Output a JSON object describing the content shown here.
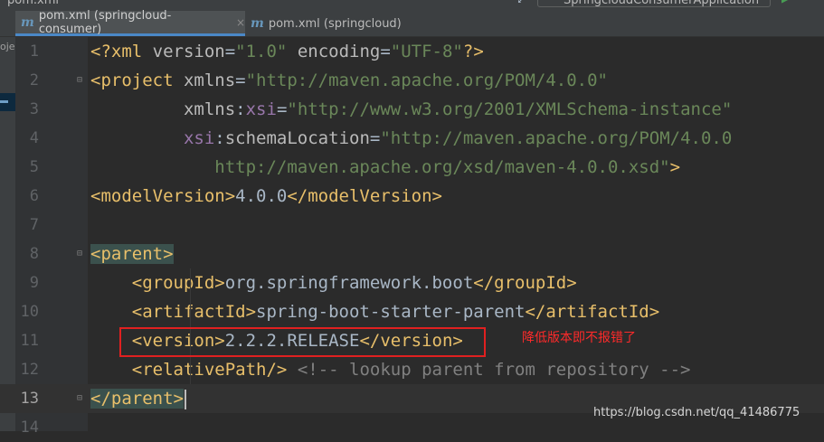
{
  "window": {
    "title": "pom.xml",
    "run_config": "SpringcloudConsumerApplication"
  },
  "tabs": [
    {
      "label": "pom.xml (springcloud-consumer)",
      "active": true,
      "close": "×"
    },
    {
      "label": "pom.xml (springcloud)",
      "active": false
    }
  ],
  "sidebar": {
    "label": "oje"
  },
  "editor": {
    "current_line": 13,
    "lines": [
      {
        "n": "1",
        "tokens": [
          [
            "tag",
            "<?xml "
          ],
          [
            "attr",
            "version"
          ],
          [
            "txt",
            "="
          ],
          [
            "str",
            "\"1.0\""
          ],
          [
            "txt",
            " "
          ],
          [
            "attr",
            "encoding"
          ],
          [
            "txt",
            "="
          ],
          [
            "str",
            "\"UTF-8\""
          ],
          [
            "tag",
            "?>"
          ]
        ]
      },
      {
        "n": "2",
        "tokens": [
          [
            "tag",
            "<project "
          ],
          [
            "attr",
            "xmlns"
          ],
          [
            "txt",
            "="
          ],
          [
            "str",
            "\"http://maven.apache.org/POM/4.0.0\""
          ]
        ]
      },
      {
        "n": "3",
        "tokens": [
          [
            "txt",
            "         "
          ],
          [
            "attr",
            "xmlns"
          ],
          [
            "txt",
            ":"
          ],
          [
            "ns",
            "xsi"
          ],
          [
            "txt",
            "="
          ],
          [
            "str",
            "\"http://www.w3.org/2001/XMLSchema-instance\""
          ]
        ]
      },
      {
        "n": "4",
        "tokens": [
          [
            "txt",
            "         "
          ],
          [
            "ns",
            "xsi"
          ],
          [
            "txt",
            ":"
          ],
          [
            "attr",
            "schemaLocation"
          ],
          [
            "txt",
            "="
          ],
          [
            "str",
            "\"http://maven.apache.org/POM/4.0.0"
          ]
        ]
      },
      {
        "n": "5",
        "tokens": [
          [
            "txt",
            "            "
          ],
          [
            "str",
            "http://maven.apache.org/xsd/maven-4.0.0.xsd\""
          ],
          [
            "tag",
            ">"
          ]
        ]
      },
      {
        "n": "6",
        "tokens": [
          [
            "tag",
            "<modelVersion>"
          ],
          [
            "txt",
            "4.0.0"
          ],
          [
            "tag",
            "</modelVersion>"
          ]
        ]
      },
      {
        "n": "7",
        "tokens": []
      },
      {
        "n": "8",
        "tokens": [
          [
            "tag hl",
            "<parent>"
          ]
        ]
      },
      {
        "n": "9",
        "tokens": [
          [
            "txt",
            "    "
          ],
          [
            "tag",
            "<groupId>"
          ],
          [
            "txt",
            "org.springframework.boot"
          ],
          [
            "tag",
            "</groupId>"
          ]
        ]
      },
      {
        "n": "10",
        "tokens": [
          [
            "txt",
            "    "
          ],
          [
            "tag",
            "<artifactId>"
          ],
          [
            "txt",
            "spring-boot-starter-parent"
          ],
          [
            "tag",
            "</artifactId>"
          ]
        ]
      },
      {
        "n": "11",
        "tokens": [
          [
            "txt",
            "    "
          ],
          [
            "tag",
            "<version>"
          ],
          [
            "txt",
            "2.2.2.RELEASE"
          ],
          [
            "tag",
            "</version>"
          ]
        ]
      },
      {
        "n": "12",
        "tokens": [
          [
            "txt",
            "    "
          ],
          [
            "tag",
            "<relativePath/>"
          ],
          [
            "txt",
            " "
          ],
          [
            "cmt",
            "<!-- lookup parent from repository -->"
          ]
        ]
      },
      {
        "n": "13",
        "tokens": [
          [
            "tag hl",
            "</parent>"
          ]
        ]
      },
      {
        "n": "14",
        "tokens": []
      }
    ]
  },
  "annotation": {
    "text": "降低版本即不报错了",
    "color": "#ff2a2a"
  },
  "watermark": {
    "text": "https://blog.csdn.net/qq_41486775"
  }
}
